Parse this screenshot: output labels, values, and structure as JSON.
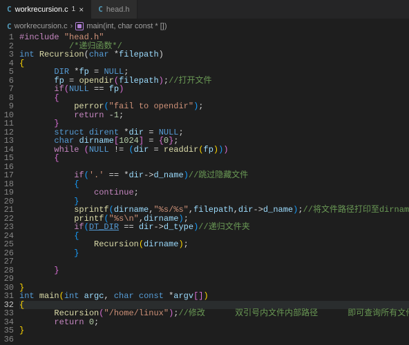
{
  "tabs": [
    {
      "icon": "C",
      "label": "workrecursion.c",
      "dirty": "1",
      "active": true
    },
    {
      "icon": "C",
      "label": "head.h",
      "active": false
    }
  ],
  "breadcrumb": {
    "icon": "C",
    "file": "workrecursion.c",
    "symbol": "main(int, char const * [])"
  },
  "currentLine": 32,
  "code": [
    [
      [
        "macro",
        "#include "
      ],
      [
        "string",
        "\"head.h\""
      ]
    ],
    [
      [
        "punc",
        "          "
      ],
      [
        "comment",
        "/*递归函数*/"
      ]
    ],
    [
      [
        "type",
        "int "
      ],
      [
        "func",
        "Recursion"
      ],
      [
        "punc",
        "("
      ],
      [
        "type",
        "char "
      ],
      [
        "punc",
        "*"
      ],
      [
        "ident",
        "filepath"
      ],
      [
        "punc",
        ")"
      ]
    ],
    [
      [
        "brY",
        "{"
      ]
    ],
    [
      [
        "punc",
        "       "
      ],
      [
        "type",
        "DIR "
      ],
      [
        "punc",
        "*"
      ],
      [
        "ident",
        "fp"
      ],
      [
        "punc",
        " = "
      ],
      [
        "const",
        "NULL"
      ],
      [
        "punc",
        ";"
      ]
    ],
    [
      [
        "punc",
        "       "
      ],
      [
        "ident",
        "fp"
      ],
      [
        "punc",
        " = "
      ],
      [
        "func",
        "opendir"
      ],
      [
        "brP",
        "("
      ],
      [
        "ident",
        "filepath"
      ],
      [
        "brP",
        ")"
      ],
      [
        "punc",
        ";"
      ],
      [
        "comment",
        "//打开文件"
      ]
    ],
    [
      [
        "punc",
        "       "
      ],
      [
        "ctrl",
        "if"
      ],
      [
        "brP",
        "("
      ],
      [
        "const",
        "NULL"
      ],
      [
        "punc",
        " == "
      ],
      [
        "ident",
        "fp"
      ],
      [
        "brP",
        ")"
      ]
    ],
    [
      [
        "punc",
        "       "
      ],
      [
        "brP",
        "{"
      ]
    ],
    [
      [
        "punc",
        "           "
      ],
      [
        "func",
        "perror"
      ],
      [
        "brB",
        "("
      ],
      [
        "string",
        "\"fail to opendir\""
      ],
      [
        "brB",
        ")"
      ],
      [
        "punc",
        ";"
      ]
    ],
    [
      [
        "punc",
        "           "
      ],
      [
        "ctrl",
        "return"
      ],
      [
        "punc",
        " -"
      ],
      [
        "num",
        "1"
      ],
      [
        "punc",
        ";"
      ]
    ],
    [
      [
        "punc",
        "       "
      ],
      [
        "brP",
        "}"
      ]
    ],
    [
      [
        "punc",
        "       "
      ],
      [
        "type",
        "struct "
      ],
      [
        "type",
        "dirent "
      ],
      [
        "punc",
        "*"
      ],
      [
        "ident",
        "dir"
      ],
      [
        "punc",
        " = "
      ],
      [
        "const",
        "NULL"
      ],
      [
        "punc",
        ";"
      ]
    ],
    [
      [
        "punc",
        "       "
      ],
      [
        "type",
        "char "
      ],
      [
        "ident",
        "dirname"
      ],
      [
        "brP",
        "["
      ],
      [
        "num",
        "1024"
      ],
      [
        "brP",
        "]"
      ],
      [
        "punc",
        " = "
      ],
      [
        "brP",
        "{"
      ],
      [
        "num",
        "0"
      ],
      [
        "brP",
        "}"
      ],
      [
        "punc",
        ";"
      ]
    ],
    [
      [
        "punc",
        "       "
      ],
      [
        "ctrl",
        "while "
      ],
      [
        "brP",
        "("
      ],
      [
        "const",
        "NULL"
      ],
      [
        "punc",
        " != "
      ],
      [
        "brB",
        "("
      ],
      [
        "ident",
        "dir"
      ],
      [
        "punc",
        " = "
      ],
      [
        "func",
        "readdir"
      ],
      [
        "brY",
        "("
      ],
      [
        "ident",
        "fp"
      ],
      [
        "brY",
        ")"
      ],
      [
        "brB",
        ")"
      ],
      [
        "brP",
        ")"
      ]
    ],
    [
      [
        "punc",
        "       "
      ],
      [
        "brP",
        "{"
      ]
    ],
    [
      [
        "punc",
        ""
      ]
    ],
    [
      [
        "punc",
        "           "
      ],
      [
        "ctrl",
        "if"
      ],
      [
        "brB",
        "("
      ],
      [
        "string",
        "'.'"
      ],
      [
        "punc",
        " == *"
      ],
      [
        "ident",
        "dir"
      ],
      [
        "punc",
        "->"
      ],
      [
        "ident",
        "d_name"
      ],
      [
        "brB",
        ")"
      ],
      [
        "comment",
        "//跳过隐藏文件"
      ]
    ],
    [
      [
        "punc",
        "           "
      ],
      [
        "brB",
        "{"
      ]
    ],
    [
      [
        "punc",
        "               "
      ],
      [
        "ctrl",
        "continue"
      ],
      [
        "punc",
        ";"
      ]
    ],
    [
      [
        "punc",
        "           "
      ],
      [
        "brB",
        "}"
      ]
    ],
    [
      [
        "punc",
        "           "
      ],
      [
        "func",
        "sprintf"
      ],
      [
        "brB",
        "("
      ],
      [
        "ident",
        "dirname"
      ],
      [
        "punc",
        ","
      ],
      [
        "string",
        "\"%s/%s\""
      ],
      [
        "punc",
        ","
      ],
      [
        "ident",
        "filepath"
      ],
      [
        "punc",
        ","
      ],
      [
        "ident",
        "dir"
      ],
      [
        "punc",
        "->"
      ],
      [
        "ident",
        "d_name"
      ],
      [
        "brB",
        ")"
      ],
      [
        "punc",
        ";"
      ],
      [
        "comment",
        "//将文件路径打印至dirname字符串数组"
      ]
    ],
    [
      [
        "punc",
        "           "
      ],
      [
        "func",
        "printf"
      ],
      [
        "brB",
        "("
      ],
      [
        "string",
        "\"%s\\n\""
      ],
      [
        "punc",
        ","
      ],
      [
        "ident",
        "dirname"
      ],
      [
        "brB",
        ")"
      ],
      [
        "punc",
        ";"
      ]
    ],
    [
      [
        "punc",
        "           "
      ],
      [
        "ctrl",
        "if"
      ],
      [
        "brB",
        "("
      ],
      [
        "constU",
        "DT_DIR"
      ],
      [
        "punc",
        " == "
      ],
      [
        "ident",
        "dir"
      ],
      [
        "punc",
        "->"
      ],
      [
        "ident",
        "d_type"
      ],
      [
        "brB",
        ")"
      ],
      [
        "comment",
        "//递归文件夹"
      ]
    ],
    [
      [
        "punc",
        "           "
      ],
      [
        "brB",
        "{"
      ]
    ],
    [
      [
        "punc",
        "               "
      ],
      [
        "func",
        "Recursion"
      ],
      [
        "brY",
        "("
      ],
      [
        "ident",
        "dirname"
      ],
      [
        "brY",
        ")"
      ],
      [
        "punc",
        ";"
      ]
    ],
    [
      [
        "punc",
        "           "
      ],
      [
        "brB",
        "}"
      ]
    ],
    [
      [
        "punc",
        ""
      ]
    ],
    [
      [
        "punc",
        "       "
      ],
      [
        "brP",
        "}"
      ]
    ],
    [
      [
        "punc",
        ""
      ]
    ],
    [
      [
        "brY",
        "}"
      ]
    ],
    [
      [
        "type",
        "int "
      ],
      [
        "func",
        "main"
      ],
      [
        "brY",
        "("
      ],
      [
        "type",
        "int "
      ],
      [
        "ident",
        "argc"
      ],
      [
        "punc",
        ", "
      ],
      [
        "type",
        "char const "
      ],
      [
        "punc",
        "*"
      ],
      [
        "ident",
        "argv"
      ],
      [
        "brP",
        "["
      ],
      [
        "brP",
        "]"
      ],
      [
        "brY",
        ")"
      ]
    ],
    [
      [
        "brY",
        "{"
      ]
    ],
    [
      [
        "punc",
        "       "
      ],
      [
        "func",
        "Recursion"
      ],
      [
        "brP",
        "("
      ],
      [
        "string",
        "\"/home/linux\""
      ],
      [
        "brP",
        ")"
      ],
      [
        "punc",
        ";"
      ],
      [
        "comment",
        "//修改      双引号内文件内部路径      即可查询所有文件"
      ]
    ],
    [
      [
        "punc",
        "       "
      ],
      [
        "ctrl",
        "return"
      ],
      [
        "punc",
        " "
      ],
      [
        "num",
        "0"
      ],
      [
        "punc",
        ";"
      ]
    ],
    [
      [
        "brY",
        "}"
      ]
    ],
    [
      [
        "punc",
        ""
      ]
    ]
  ]
}
